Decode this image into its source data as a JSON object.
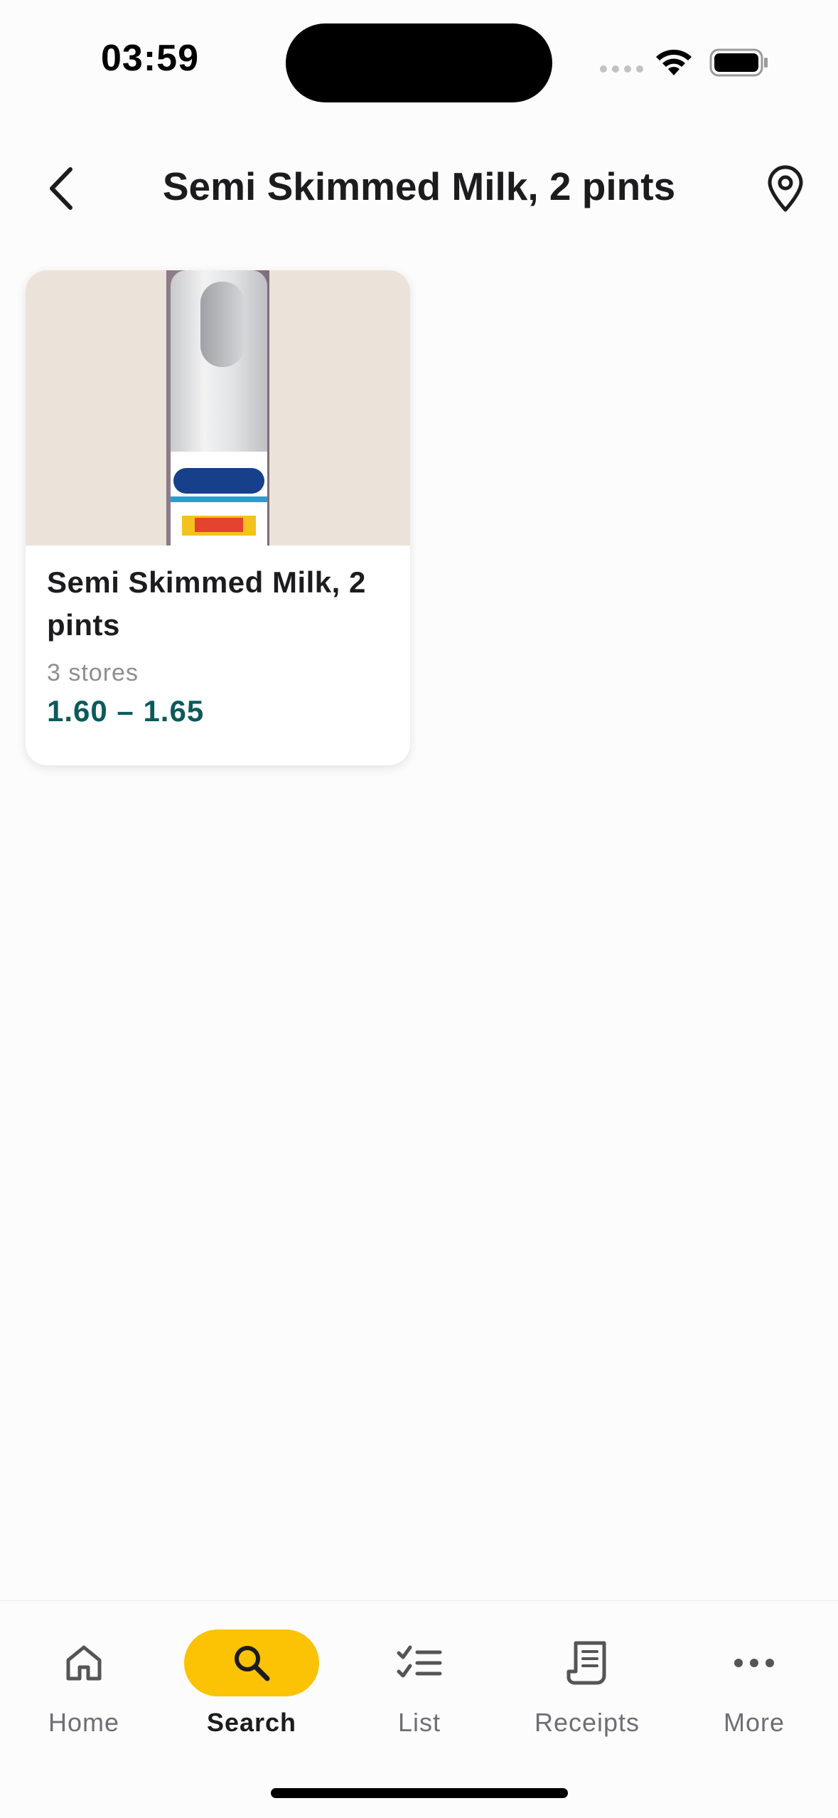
{
  "status_bar": {
    "time": "03:59"
  },
  "header": {
    "title": "Semi Skimmed Milk, 2 pints",
    "back_icon": "chevron-left-icon",
    "location_icon": "map-pin-icon"
  },
  "product_card": {
    "name": "Semi Skimmed Milk, 2 pints",
    "stores": "3 stores",
    "price_range": "1.60 – 1.65"
  },
  "nav": {
    "items": [
      {
        "label": "Home",
        "icon": "home-icon",
        "active": false
      },
      {
        "label": "Search",
        "icon": "search-icon",
        "active": true
      },
      {
        "label": "List",
        "icon": "checklist-icon",
        "active": false
      },
      {
        "label": "Receipts",
        "icon": "receipt-icon",
        "active": false
      },
      {
        "label": "More",
        "icon": "more-icon",
        "active": false
      }
    ]
  },
  "colors": {
    "accent": "#fbc303",
    "price": "#0c5b5b",
    "background": "#fcfcfc"
  }
}
